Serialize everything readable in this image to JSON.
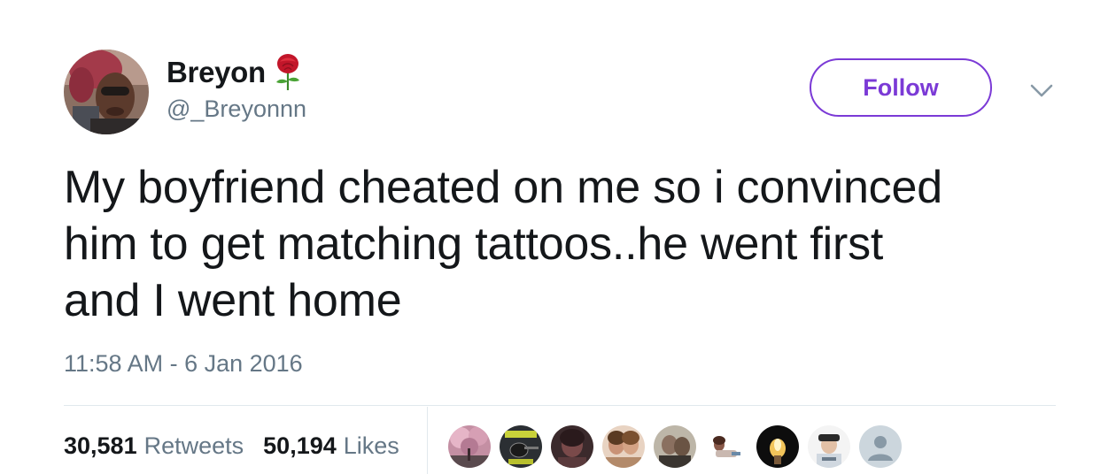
{
  "user": {
    "display_name": "Breyon",
    "handle": "@_Breyonnn",
    "emoji_icon": "rose-icon"
  },
  "follow_button": {
    "label": "Follow",
    "color": "#7b3ad6"
  },
  "tweet": {
    "lines": [
      "My boyfriend cheated on me so i convinced",
      "him to get matching tattoos..he went first",
      "and I went home"
    ],
    "timestamp": "11:58 AM - 6 Jan 2016"
  },
  "stats": {
    "retweets_count": "30,581",
    "retweets_label": "Retweets",
    "likes_count": "50,194",
    "likes_label": "Likes"
  },
  "likers": {
    "count_shown": 9,
    "avatar_icons": [
      "liker-avatar-cherry-blossom",
      "liker-avatar-guitar-sign",
      "liker-avatar-dark-selfie",
      "liker-avatar-two-friends",
      "liker-avatar-couple",
      "liker-avatar-cartoon-figure",
      "liker-avatar-candle",
      "liker-avatar-cap-person",
      "liker-avatar-default-profile"
    ]
  },
  "colors": {
    "text_primary": "#14171a",
    "text_secondary": "#657786",
    "divider": "#e1e8ed",
    "accent": "#7b3ad6"
  }
}
